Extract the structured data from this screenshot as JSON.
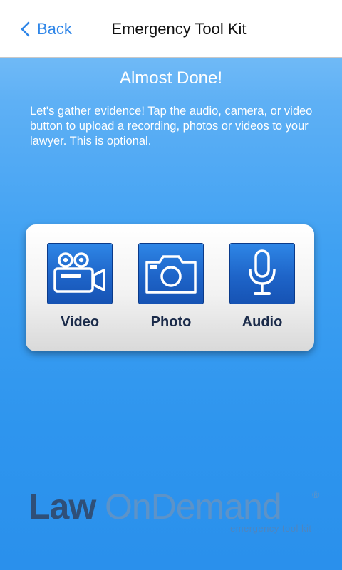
{
  "navbar": {
    "back_label": "Back",
    "title": "Emergency Tool Kit"
  },
  "main": {
    "headline": "Almost Done!",
    "description": "Let's gather evidence! Tap the audio, camera, or video button to upload a recording, photos or videos to your lawyer. This is optional."
  },
  "media_buttons": [
    {
      "label": "Video",
      "icon": "video-camera-icon"
    },
    {
      "label": "Photo",
      "icon": "camera-icon"
    },
    {
      "label": "Audio",
      "icon": "microphone-icon"
    }
  ],
  "logo": {
    "part1": "Law",
    "part2": "OnDemand",
    "registered": "®",
    "tagline": "emergency tool kit"
  },
  "colors": {
    "accent": "#2f86e8",
    "background_top": "#86c6f8",
    "background_bottom": "#2a90ec",
    "tile_blue": "#1e64c8",
    "label_dark": "#1b2b4a"
  }
}
